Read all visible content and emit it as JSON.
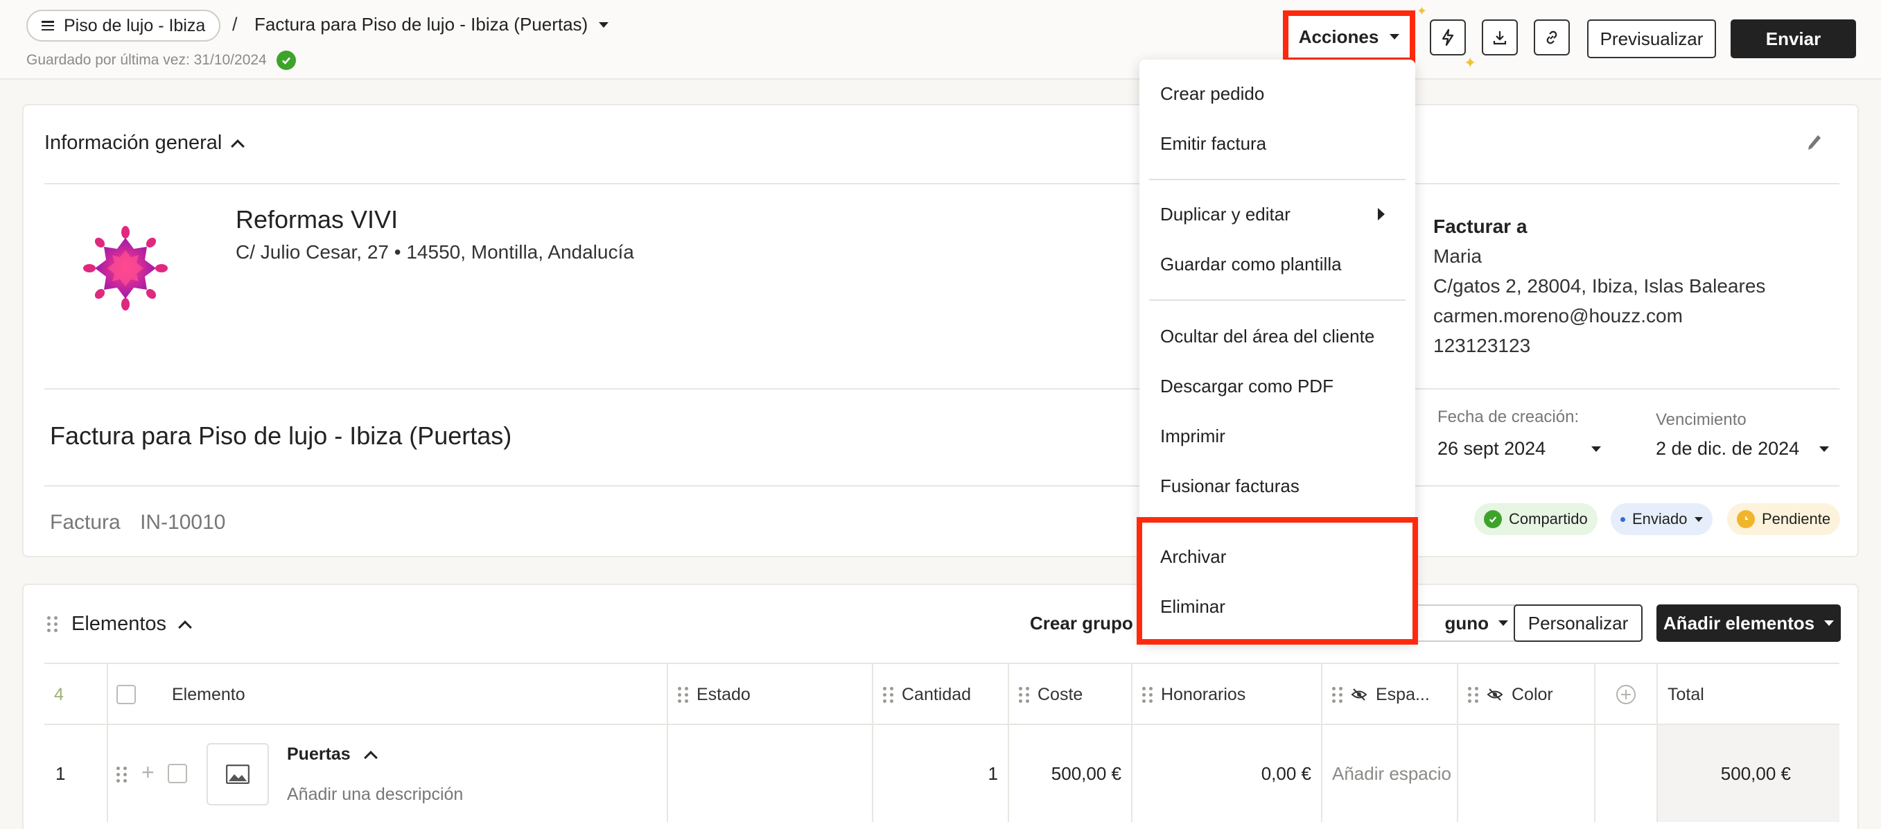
{
  "header": {
    "project": "Piso de lujo - Ibiza",
    "separator": "/",
    "doc_title": "Factura para Piso de lujo - Ibiza (Puertas)",
    "saved_text": "Guardado por última vez: 31/10/2024",
    "actions_label": "Acciones",
    "preview_label": "Previsualizar",
    "send_label": "Enviar",
    "icons": [
      "bolt-icon",
      "download-icon",
      "link-icon"
    ]
  },
  "menu": {
    "items": [
      "Crear pedido",
      "Emitir factura",
      "Duplicar y editar",
      "Guardar como plantilla",
      "Ocultar del área del cliente",
      "Descargar como PDF",
      "Imprimir",
      "Fusionar facturas",
      "Archivar",
      "Eliminar"
    ]
  },
  "general": {
    "title": "Información general",
    "company": "Reformas VIVI",
    "address": "C/ Julio Cesar, 27  •  14550, Montilla, Andalucía",
    "bill_to": {
      "label": "Facturar a",
      "name": "Maria",
      "address": "C/gatos 2, 28004, Ibiza, Islas Baleares",
      "email": "carmen.moreno@houzz.com",
      "phone": "123123123"
    },
    "invoice_title": "Factura para Piso de lujo - Ibiza (Puertas)",
    "created_label": "Fecha de creación:",
    "created_value": "26 sept 2024",
    "due_label": "Vencimiento",
    "due_value": "2 de dic. de 2024",
    "invoice_label": "Factura",
    "invoice_number": "IN-10010",
    "badges": {
      "shared": "Compartido",
      "sent": "Enviado",
      "pending": "Pendiente"
    },
    "colors": {
      "shared_bg": "#e7f5e3",
      "sent_bg": "#e6eefb",
      "pending_bg": "#fdf3dc",
      "highlight": "#ff2a0e"
    }
  },
  "elements": {
    "title": "Elementos",
    "create_group": "Crear grupo",
    "group_select": "guno",
    "customize": "Personalizar",
    "add_elements": "Añadir elementos",
    "count": "4",
    "columns": [
      "Elemento",
      "Estado",
      "Cantidad",
      "Coste",
      "Honorarios",
      "Espa...",
      "Color",
      "Total"
    ],
    "row": {
      "index": "1",
      "name": "Puertas",
      "description": "Añadir una descripción",
      "quantity": "1",
      "cost": "500,00 €",
      "fees": "0,00 €",
      "space": "Añadir espacio",
      "total": "500,00 €"
    }
  }
}
